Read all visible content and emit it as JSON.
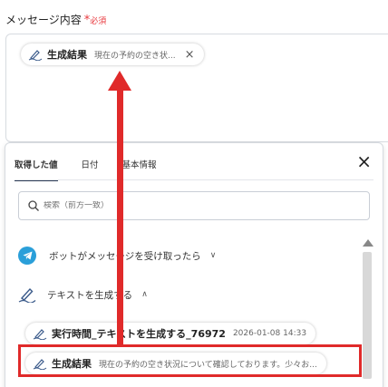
{
  "field": {
    "label": "メッセージ内容",
    "required_mark": "*",
    "required_text": "必須"
  },
  "inserted_chip": {
    "title": "生成結果",
    "preview": "現在の予約の空き状...",
    "close_icon": "×"
  },
  "panel": {
    "tabs": [
      {
        "label": "取得した値",
        "active": true
      },
      {
        "label": "日付",
        "active": false
      },
      {
        "label": "基本情報",
        "active": false
      }
    ],
    "close_icon": "×",
    "search": {
      "placeholder": "検索（前方一致）"
    },
    "sections": [
      {
        "label": "ボットがメッセージを受け取ったら",
        "expanded": false
      },
      {
        "label": "テキストを生成する",
        "expanded": true
      }
    ],
    "values": [
      {
        "title": "実行時間_テキストを生成する_76972",
        "preview": "2026-01-08 14:33"
      },
      {
        "title": "生成結果",
        "preview": "現在の予約の空き状況について確認しております。少々お..."
      }
    ]
  },
  "colors": {
    "accent_red": "#e02a2a",
    "telegram_blue": "#2a9fd9",
    "required_red": "#e8383d"
  }
}
